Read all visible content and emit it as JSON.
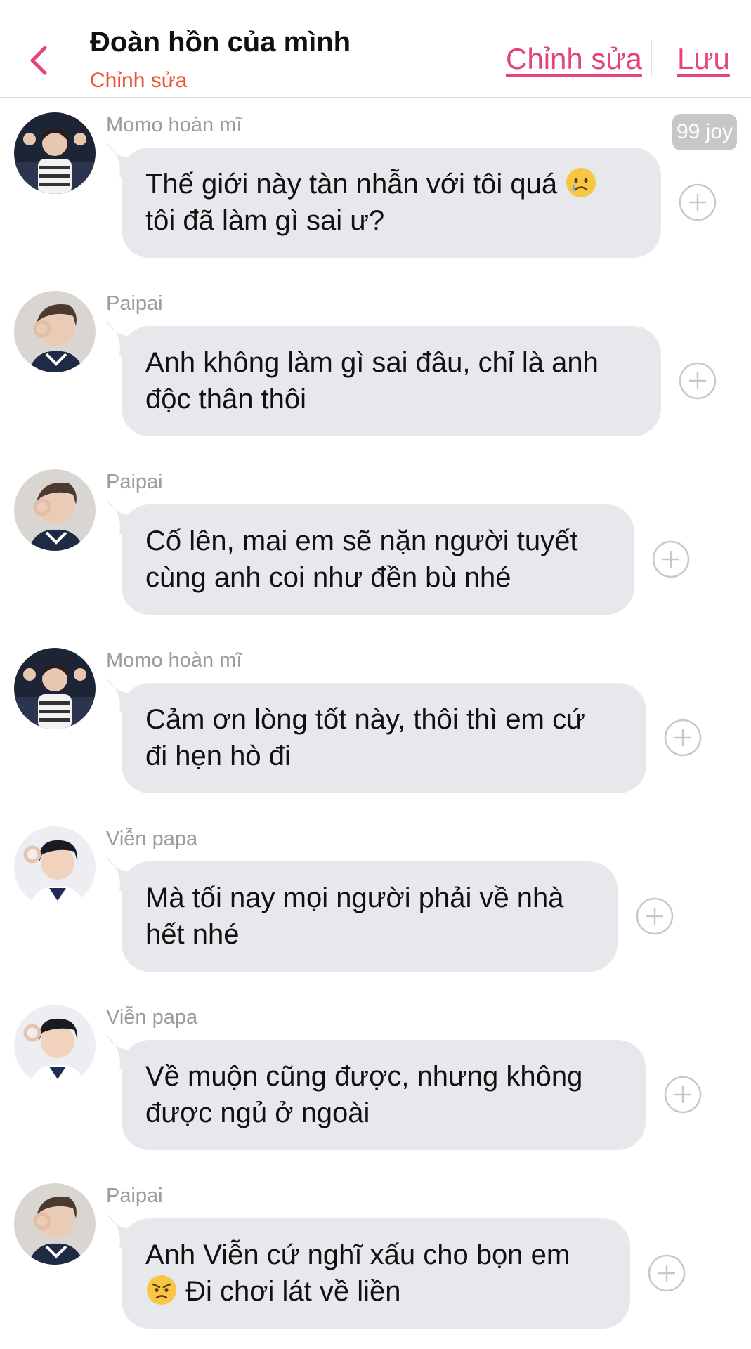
{
  "header": {
    "title": "Đoàn hồn của mình",
    "subtitle": "Chỉnh sửa",
    "edit_label": "Chỉnh sửa",
    "save_label": "Lưu"
  },
  "colors": {
    "accent_pink": "#e5447a",
    "accent_orange": "#e8542c",
    "bubble_bg": "#e6e8ec"
  },
  "messages": [
    {
      "sender": "Momo hoàn mĩ",
      "avatar": "avatar-momo",
      "line1": "Thế giới này tàn nhẫn với tôi quá",
      "line1_emoji": "crying-face-emoji",
      "line2": "tôi đã làm gì sai ư?",
      "badge": "99 joy"
    },
    {
      "sender": "Paipai",
      "avatar": "avatar-paipai",
      "line1": "Anh không làm gì sai đâu, chỉ là anh",
      "line2": "độc thân thôi"
    },
    {
      "sender": "Paipai",
      "avatar": "avatar-paipai",
      "line1": "Cố lên, mai em sẽ nặn người tuyết",
      "line2": "cùng anh coi như đền bù nhé"
    },
    {
      "sender": "Momo hoàn mĩ",
      "avatar": "avatar-momo",
      "line1": "Cảm ơn lòng tốt này, thôi thì em cứ",
      "line2": "đi hẹn hò đi"
    },
    {
      "sender": "Viễn papa",
      "avatar": "avatar-vien",
      "line1": "Mà tối nay mọi người phải về nhà",
      "line2": "hết nhé"
    },
    {
      "sender": "Viễn papa",
      "avatar": "avatar-vien",
      "line1": "Về muộn cũng được, nhưng không",
      "line2": "được ngủ ở ngoài"
    },
    {
      "sender": "Paipai",
      "avatar": "avatar-paipai",
      "line1": "Anh Viễn cứ nghĩ xấu cho bọn em",
      "line2_emoji": "angry-face-emoji",
      "line2": "Đi chơi lát về liền"
    }
  ]
}
